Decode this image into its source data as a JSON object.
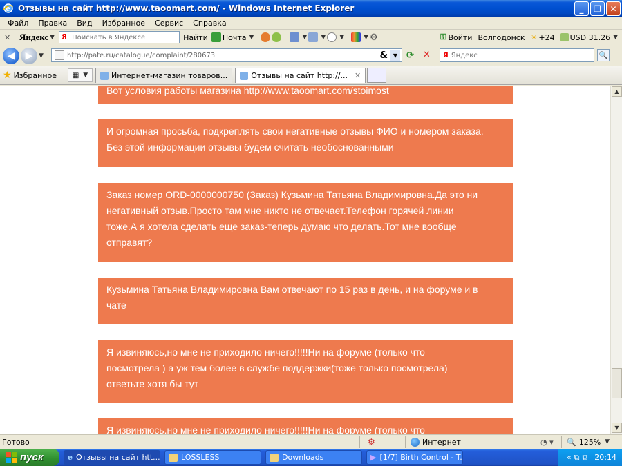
{
  "window": {
    "title": "Отзывы на сайт http://www.taoomart.com/ - Windows Internet Explorer"
  },
  "menu": [
    "Файл",
    "Правка",
    "Вид",
    "Избранное",
    "Сервис",
    "Справка"
  ],
  "yandex_bar": {
    "logo": "Яндекс",
    "search_placeholder": "Поискать в Яндексе",
    "find_label": "Найти",
    "mail_label": "Почта",
    "login_label": "Войти",
    "city_label": "Волгодонск",
    "weather_label": "+24",
    "currency_label": "USD 31.26"
  },
  "address_bar": {
    "url": "http://pate.ru/catalogue/complaint/280673",
    "search_placeholder": "Яндекс"
  },
  "tabs_bar": {
    "favorites_label": "Избранное",
    "tabs": [
      {
        "title": "Интернет-магазин товаров...",
        "active": false
      },
      {
        "title": "Отзывы на сайт http://...",
        "active": true
      }
    ]
  },
  "comments": [
    {
      "text": "Вот условия работы магазина http://www.taoomart.com/stoimost"
    },
    {
      "lines": [
        "И огромная просьба, подкреплять свои негативные отзывы ФИО и номером заказа.",
        "Без этой информации отзывы будем считать необоснованными"
      ]
    },
    {
      "lines": [
        "Заказ номер ORD-0000000750 (Заказ) Кузьмина Татьяна Владимировна.Да это ни",
        "негативный отзыв.Просто там мне никто не отвечает.Телефон горячей линии",
        "тоже.А я хотела сделать еще заказ-теперь думаю что делать.Тот мне вообще",
        "отправят?"
      ]
    },
    {
      "lines": [
        "Кузьмина Татьяна Владимировна Вам отвечают по 15 раз в день, и на форуме и в",
        "чате"
      ]
    },
    {
      "lines": [
        "Я извиняюсь,но мне не приходило ничего!!!!!Ни на форуме (только что",
        "посмотрела ) а уж тем более в службе поддержки(тоже только посмотрела)",
        "ответьте хотя бы тут"
      ]
    },
    {
      "text": "Я извиняюсь,но мне не приходило ничего!!!!!Ни на форуме (только что"
    }
  ],
  "status_bar": {
    "status": "Готово",
    "zone": "Интернет",
    "zoom": "125%"
  },
  "taskbar": {
    "start_label": "пуск",
    "tasks": [
      {
        "label": "Отзывы на сайт htt...",
        "active": true
      },
      {
        "label": "LOSSLESS",
        "active": false
      },
      {
        "label": "Downloads",
        "active": false
      },
      {
        "label": "[1/7] Birth Control - T...",
        "active": false
      }
    ],
    "clock": "20:14"
  },
  "colors": {
    "comment_bg": "#ee7a4e",
    "titlebar": "#0050d0",
    "taskbar": "#245edb",
    "start": "#2f8f2f"
  }
}
